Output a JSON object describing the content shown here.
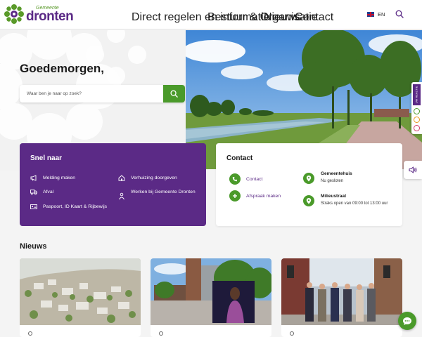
{
  "header": {
    "logo_small": "Gemeente",
    "logo_big": "dronten",
    "nav": [
      {
        "label": "Direct regelen en informatie",
        "has_dropdown": true
      },
      {
        "label": "Bestuur & Organisatie",
        "has_dropdown": false
      },
      {
        "label": "Nieuws",
        "has_dropdown": true
      },
      {
        "label": "Contact",
        "has_dropdown": false
      }
    ],
    "language": "EN"
  },
  "hero": {
    "greeting": "Goedemorgen,",
    "search_placeholder": "Waar ben je naar op zoek?"
  },
  "side": {
    "badge_text": "UW REACTIE"
  },
  "snel_naar": {
    "title": "Snel naar",
    "items": [
      {
        "label": "Melding maken",
        "icon": "megaphone-icon"
      },
      {
        "label": "Afval",
        "icon": "truck-icon"
      },
      {
        "label": "Paspoort, ID Kaart & Rijbewijs",
        "icon": "id-card-icon"
      },
      {
        "label": "Verhuizing doorgeven",
        "icon": "house-icon"
      },
      {
        "label": "Werken bij Gemeente Dronten",
        "icon": "person-icon"
      }
    ]
  },
  "contact": {
    "title": "Contact",
    "links": [
      {
        "label": "Contact",
        "icon": "phone-icon"
      },
      {
        "label": "Afspraak maken",
        "icon": "plus-icon"
      }
    ],
    "locations": [
      {
        "name": "Gemeentehuis",
        "status": "Nu gesloten"
      },
      {
        "name": "Milieustraat",
        "status": "Straks open van 09:00 tot 13:00 uur"
      }
    ]
  },
  "nieuws": {
    "title": "Nieuws"
  },
  "colors": {
    "brand_purple": "#5b2a86",
    "brand_green": "#4a9a2a"
  }
}
